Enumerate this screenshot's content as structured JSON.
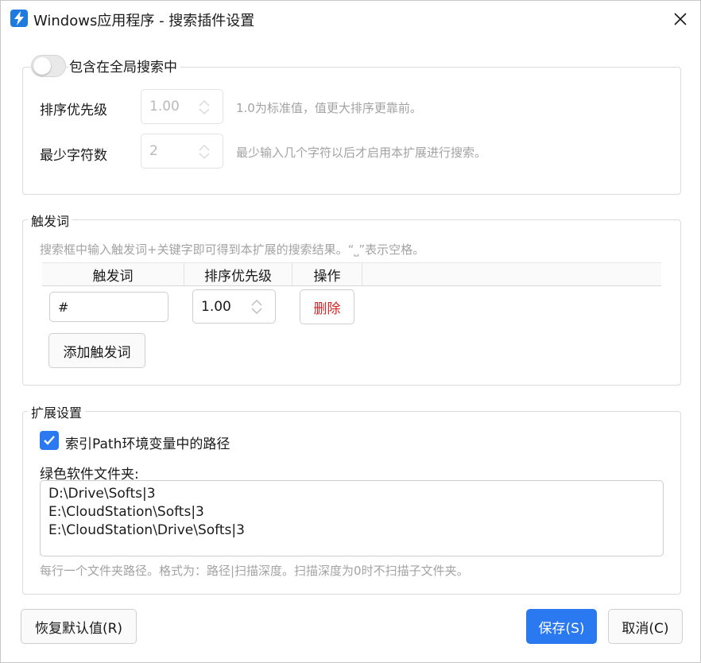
{
  "window": {
    "title": "Windows应用程序 - 搜索插件设置"
  },
  "global_search": {
    "toggle_label": "包含在全局搜索中",
    "enabled": false,
    "priority_label": "排序优先级",
    "priority_value": "1.00",
    "priority_hint": "1.0为标准值，值更大排序更靠前。",
    "min_chars_label": "最少字符数",
    "min_chars_value": "2",
    "min_chars_hint": "最少输入几个字符以后才启用本扩展进行搜索。"
  },
  "triggers": {
    "group_title": "触发词",
    "hint": "搜索框中输入触发词+关键字即可得到本扩展的搜索结果。“⎵”表示空格。",
    "columns": [
      "触发词",
      "排序优先级",
      "操作"
    ],
    "rows": [
      {
        "trigger": "#",
        "priority": "1.00",
        "action": "删除"
      }
    ],
    "add_button": "添加触发词"
  },
  "extension": {
    "group_title": "扩展设置",
    "index_path_label": "索引Path环境变量中的路径",
    "index_path_checked": true,
    "folders_label": "绿色软件文件夹:",
    "folders": [
      "D:\\Drive\\Softs|3",
      "E:\\CloudStation\\Softs|3",
      "E:\\CloudStation\\Drive\\Softs|3"
    ],
    "folders_hint": "每行一个文件夹路径。格式为：路径|扫描深度。扫描深度为0时不扫描子文件夹。"
  },
  "footer": {
    "reset_button": "恢复默认值(R)",
    "save_button": "保存(S)",
    "cancel_button": "取消(C)"
  },
  "colors": {
    "accent": "#2b79f0",
    "danger": "#d62525",
    "hint_text": "#a3a3a3"
  }
}
